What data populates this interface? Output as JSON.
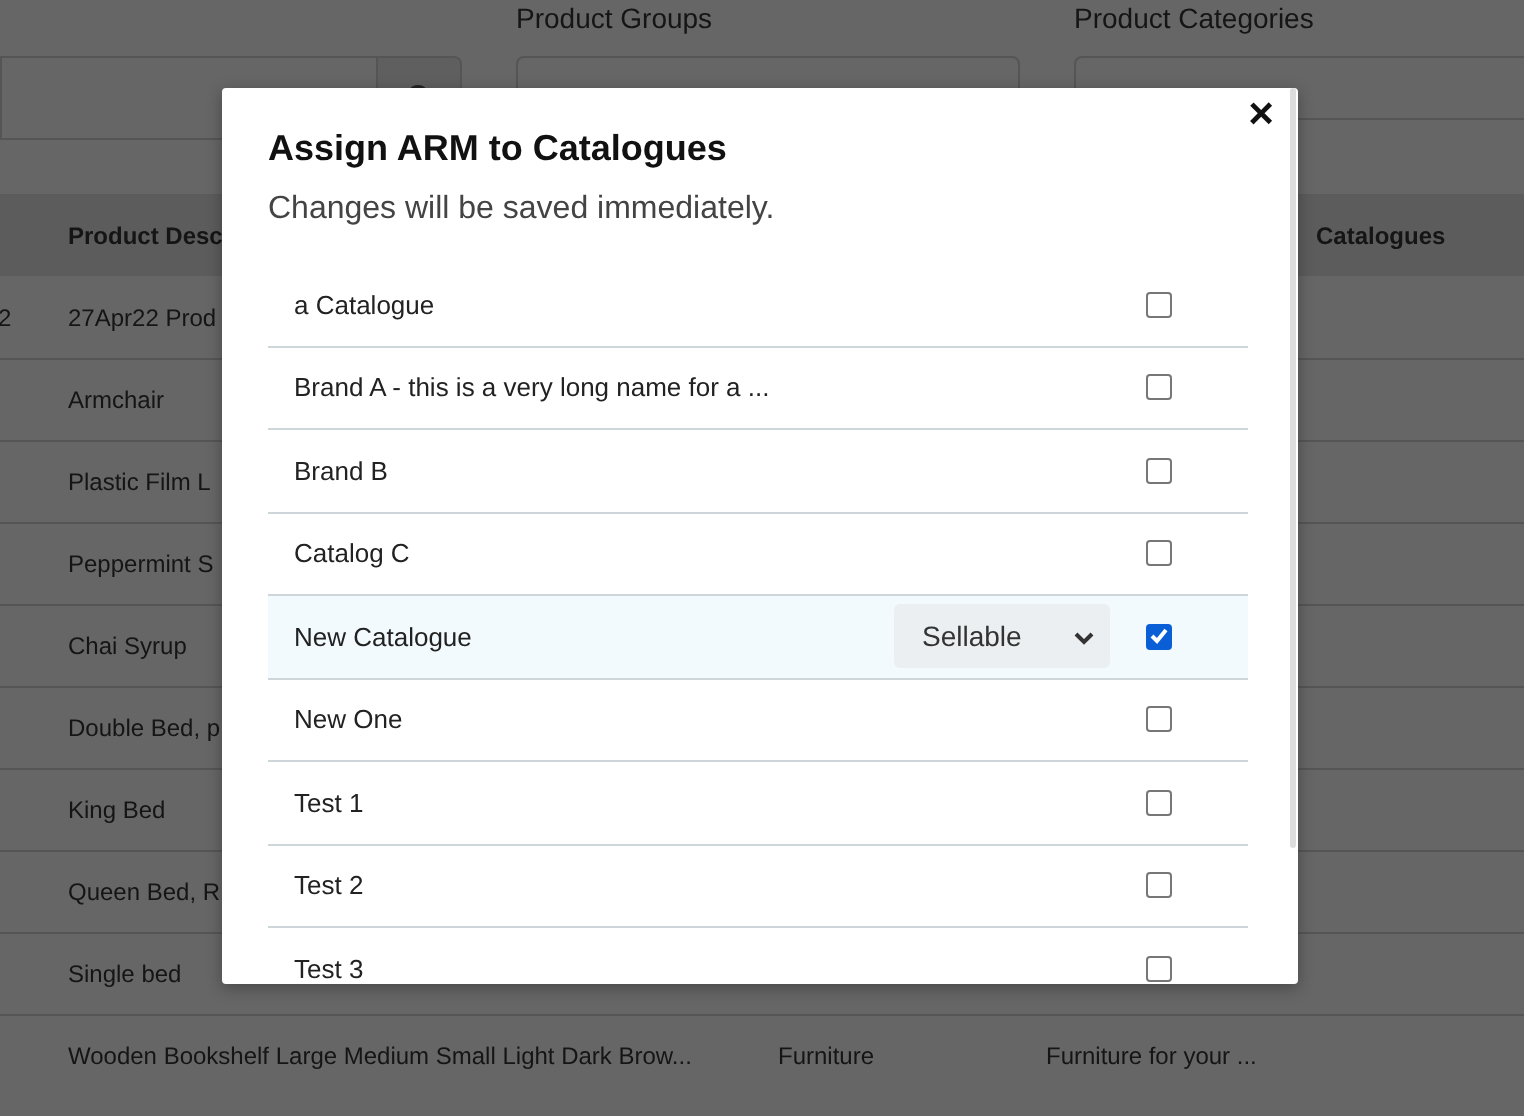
{
  "filters": [
    {
      "label": "Product Groups"
    },
    {
      "label": "Product Categories"
    }
  ],
  "table": {
    "header": {
      "column_2": "Product Desc",
      "column_5": "Catalogues"
    },
    "rows": [
      {
        "column_1": "2",
        "column_2": "27Apr22 Prod"
      },
      {
        "column_2": "Armchair"
      },
      {
        "column_2": "Plastic Film L"
      },
      {
        "column_2": "Peppermint S"
      },
      {
        "column_2": "Chai Syrup"
      },
      {
        "column_2": "Double Bed, p"
      },
      {
        "column_2": "King Bed"
      },
      {
        "column_2": "Queen Bed, R"
      },
      {
        "column_2": "Single bed"
      },
      {
        "column_2": "Wooden Bookshelf Large Medium Small Light Dark Brow...",
        "column_3": "Furniture",
        "column_4": "Furniture for your ..."
      }
    ]
  },
  "modal": {
    "title": "Assign ARM to Catalogues",
    "subtitle": "Changes will be saved immediately.",
    "close": "×",
    "catalogues": [
      {
        "name": "a Catalogue",
        "checked": false
      },
      {
        "name": "Brand A - this is a very long name for a ...",
        "checked": false
      },
      {
        "name": "Brand B",
        "checked": false
      },
      {
        "name": "Catalog C",
        "checked": false
      },
      {
        "name": "New Catalogue",
        "checked": true,
        "option": "Sellable"
      },
      {
        "name": "New One",
        "checked": false
      },
      {
        "name": "Test 1",
        "checked": false
      },
      {
        "name": "Test 2",
        "checked": false
      },
      {
        "name": "Test 3",
        "checked": false
      }
    ]
  }
}
